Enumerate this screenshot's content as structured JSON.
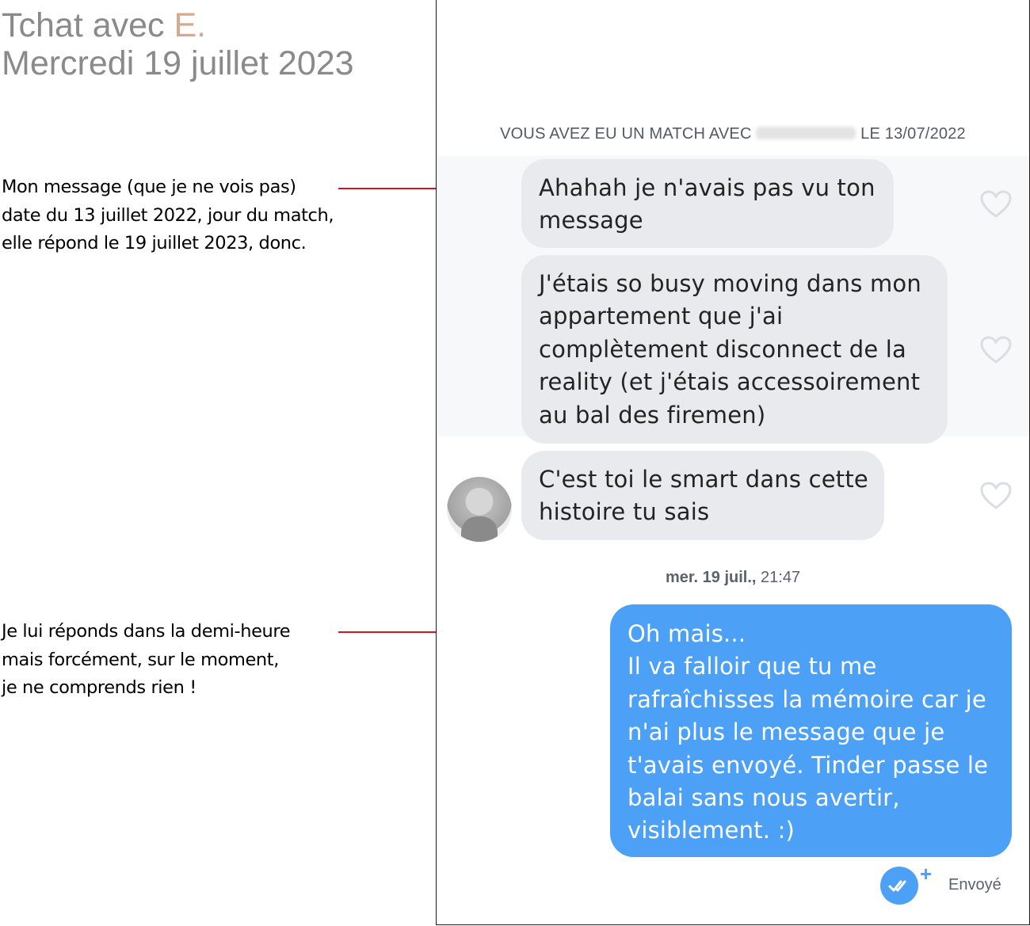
{
  "page": {
    "title_prefix": "Tchat avec ",
    "title_initial": "E.",
    "title_date": "Mercredi 19 juillet 2023"
  },
  "annotations": {
    "first": [
      "Mon message (que je ne vois pas)",
      "date du 13 juillet 2022, jour du match,",
      "elle répond le 19 juillet 2023, donc."
    ],
    "second": [
      "Je lui réponds dans la demi-heure",
      "mais forcément, sur le moment,",
      "je ne comprends rien !"
    ]
  },
  "header": {
    "back_icon": "chevron-left-icon",
    "video_icon": "video-camera-icon",
    "safety_icon": "shield-icon",
    "verified_icon": "verified-badge-icon"
  },
  "thread": {
    "match_banner_prefix": "VOUS AVEZ EU UN MATCH AVEC",
    "match_banner_suffix": "LE 13/07/2022",
    "timestamp_day": "mer. 19 juil.,",
    "timestamp_time": " 21:47",
    "received": [
      {
        "lines": [
          "Ahahah je n'avais pas vu ton",
          "message"
        ]
      },
      {
        "lines": [
          "J'étais so busy moving dans mon",
          "appartement que j'ai",
          "complètement disconnect de la",
          "reality (et j'étais accessoirement",
          "au bal des firemen)"
        ]
      },
      {
        "lines": [
          "C'est toi le smart dans cette",
          "histoire tu sais"
        ]
      }
    ],
    "sent": {
      "lines": [
        "Oh mais...",
        "Il va falloir que tu me",
        "rafraîchisses  la mémoire car je",
        "n'ai plus le message que je",
        "t'avais envoyé. Tinder passe le",
        "balai sans nous avertir,",
        "visiblement. :)"
      ]
    },
    "sent_status": "Envoyé",
    "plus_mark": "+"
  },
  "colors": {
    "accent_blue": "#4ca1f7",
    "received_bubble": "#e9eaee",
    "annotation_line": "#d01626",
    "title_grey": "#8a8a8a",
    "initial_color": "#d7a98a"
  }
}
